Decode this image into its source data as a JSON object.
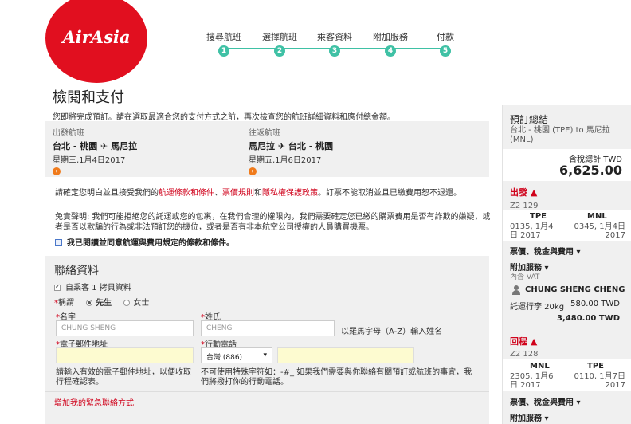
{
  "brand": {
    "logo_text": "AirAsia",
    "color": "#e10f1f",
    "accent": "#3fc1a5"
  },
  "steps": [
    {
      "label": "搜尋航班",
      "num": "1"
    },
    {
      "label": "選擇航班",
      "num": "2"
    },
    {
      "label": "乘客資料",
      "num": "3"
    },
    {
      "label": "附加服務",
      "num": "4"
    },
    {
      "label": "付款",
      "num": "5"
    }
  ],
  "page": {
    "title": "檢閱和支付",
    "subtitle": "您即將完成預訂。請在選取最適合您的支付方式之前，再次檢查您的航班詳細資料和應付總金額。"
  },
  "outbound": {
    "label": "出發航班",
    "route": "台北 - 桃園 ✈ 馬尼拉",
    "date": "星期三,1月4日2017",
    "arrow": "›"
  },
  "return": {
    "label": "往返航班",
    "route": "馬尼拉 ✈ 台北 - 桃園",
    "date": "星期五,1月6日2017",
    "arrow": "›"
  },
  "terms": {
    "prefix": "請確定您明白並且接受我們的",
    "link1": "航運條款和條件",
    "sep1": "、",
    "link2": "票價規則",
    "sep2": "和",
    "link3": "隱私權保護政策",
    "suffix": "。訂票不能取消並且已繳費用恕不退還。",
    "disclaimer": "免責聲明: 我們可能拒絕您的託運或您的包裹，在我們合理的權限內，我們需要確定您已繳的購票費用是否有詐欺的嫌疑，或者是否以欺騙的行為或非法預訂您的機位，或者是否有非本航空公司授權的人員購買機票。",
    "agree": "我已閱讀並同意航運與費用規定的條款和條件。"
  },
  "contact": {
    "title": "聯絡資料",
    "copy_label": "自乘客 1 拷貝資料",
    "title_label": "稱謂",
    "mr": "先生",
    "ms": "女士",
    "first_name_label": "名字",
    "first_name_value": "CHUNG SHENG",
    "last_name_label": "姓氏",
    "last_name_value": "CHENG",
    "name_hint": "以羅馬字母（A-Z）輸入姓名",
    "email_label": "電子郵件地址",
    "email_value": "",
    "mobile_label": "行動電話",
    "country_code": "台灣 (886)",
    "phone_value": "",
    "email_note": "請輸入有效的電子郵件地址，以便收取行程確認表。",
    "phone_note": "不可使用特殊字符如：-#_ 如果我們需要與你聯絡有關預訂或航班的事宜，我們將撥打你的行動電話。",
    "emergency_link": "增加我的緊急聯絡方式"
  },
  "sidebar": {
    "title": "預訂總結",
    "route": "台北 - 桃園 (TPE) to 馬尼拉 (MNL)",
    "total_label": "含稅總計 TWD",
    "total": "6,625.00",
    "depart_head": "出發 ▲",
    "depart_flight": "Z2 129",
    "depart_from": "TPE",
    "depart_to": "MNL",
    "depart_from_time": "0135, 1月4日 2017",
    "depart_to_time": "0345, 1月4日 2017",
    "fare_tax": "票價、稅金與費用 ▾",
    "addons": "附加服務 ▾",
    "vat": "內含 VAT",
    "passenger": "CHUNG SHENG CHENG",
    "baggage_label": "託運行李 20kg",
    "baggage_price": "580.00 TWD",
    "subtotal": "3,480.00 TWD",
    "return_head": "回程 ▲",
    "return_flight": "Z2 128",
    "return_from": "MNL",
    "return_to": "TPE",
    "return_from_time": "2305, 1月6日 2017",
    "return_to_time": "0110, 1月7日 2017",
    "fare_tax2": "票價、稅金與費用 ▾",
    "addons2": "附加服務 ▾"
  }
}
